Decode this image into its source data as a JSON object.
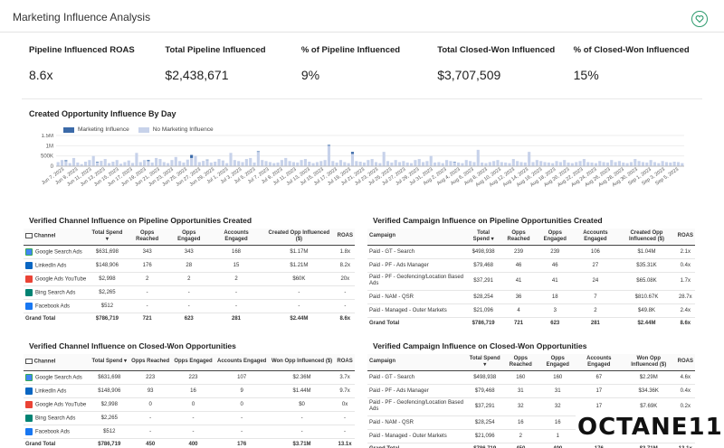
{
  "app_title": "Marketing Influence Analysis",
  "colors": {
    "accent": "#2e9b6e",
    "marketing": "#3b6aa8",
    "no_marketing": "#c7d2ea"
  },
  "kpis": [
    {
      "label": "Pipeline Influenced ROAS",
      "value": "8.6x"
    },
    {
      "label": "Total Pipeline Influenced",
      "value": "$2,438,671"
    },
    {
      "label": "% of Pipeline Influenced",
      "value": "9%"
    },
    {
      "label": "Total Closed-Won Influenced",
      "value": "$3,707,509"
    },
    {
      "label": "% of Closed-Won Influenced",
      "value": "15%"
    }
  ],
  "chart_data": {
    "type": "bar",
    "title": "Created Opportunity Influence By Day",
    "ylim": [
      0,
      1500000
    ],
    "yticks": [
      0,
      500000,
      1000000,
      1500000
    ],
    "ytick_labels": [
      "0",
      "500K",
      "1M",
      "1.5M"
    ],
    "x_tick_labels": [
      "Jun 7, 2023",
      "Jun 9, 2023",
      "Jun 11, 2023",
      "Jun 13, 2023",
      "Jun 15, 2023",
      "Jun 17, 2023",
      "Jun 19, 2023",
      "Jun 21, 2023",
      "Jun 23, 2023",
      "Jun 25, 2023",
      "Jun 27, 2023",
      "Jun 29, 2023",
      "Jul 1, 2023",
      "Jul 3, 2023",
      "Jul 5, 2023",
      "Jul 7, 2023",
      "Jul 9, 2023",
      "Jul 11, 2023",
      "Jul 13, 2023",
      "Jul 15, 2023",
      "Jul 17, 2023",
      "Jul 19, 2023",
      "Jul 21, 2023",
      "Jul 23, 2023",
      "Jul 25, 2023",
      "Jul 27, 2023",
      "Jul 29, 2023",
      "Jul 31, 2023",
      "Aug 2, 2023",
      "Aug 4, 2023",
      "Aug 6, 2023",
      "Aug 8, 2023",
      "Aug 10, 2023",
      "Aug 12, 2023",
      "Aug 14, 2023",
      "Aug 16, 2023",
      "Aug 18, 2023",
      "Aug 20, 2023",
      "Aug 22, 2023",
      "Aug 24, 2023",
      "Aug 26, 2023",
      "Aug 28, 2023",
      "Aug 30, 2023",
      "Sep 1, 2023",
      "Sep 3, 2023",
      "Sep 5, 2023"
    ],
    "series": [
      {
        "name": "Marketing Influence",
        "values": [
          0,
          0,
          40000,
          0,
          0,
          0,
          0,
          0,
          0,
          0,
          30000,
          0,
          0,
          0,
          0,
          0,
          0,
          0,
          0,
          0,
          0,
          0,
          0,
          50000,
          0,
          0,
          0,
          0,
          0,
          0,
          0,
          0,
          0,
          0,
          150000,
          0,
          0,
          0,
          20000,
          0,
          0,
          0,
          0,
          0,
          0,
          0,
          0,
          0,
          0,
          0,
          0,
          30000,
          0,
          0,
          0,
          0,
          0,
          0,
          0,
          0,
          0,
          0,
          0,
          0,
          0,
          0,
          0,
          0,
          0,
          40000,
          0,
          0,
          0,
          0,
          0,
          100000,
          0,
          0,
          0,
          0,
          0,
          0,
          0,
          0,
          0,
          0,
          0,
          0,
          0,
          0,
          0,
          0,
          0,
          0,
          0,
          0,
          0,
          0,
          0,
          0,
          0,
          20000,
          0,
          0,
          0,
          0,
          0,
          0,
          0,
          0,
          0,
          0,
          0,
          0,
          0,
          0,
          0,
          0,
          0,
          0,
          0,
          0,
          0,
          0,
          0,
          0,
          0,
          0,
          0,
          0,
          0,
          0,
          0,
          0,
          0,
          0,
          0,
          0,
          0,
          0,
          0,
          0,
          0,
          0,
          0,
          0,
          0,
          0,
          0,
          0,
          0,
          0,
          0,
          0,
          0,
          0,
          0,
          0,
          0,
          0,
          0,
          0,
          0,
          0
        ]
      },
      {
        "name": "No Marketing Influence",
        "values": [
          200000,
          300000,
          250000,
          150000,
          400000,
          180000,
          100000,
          220000,
          300000,
          500000,
          180000,
          260000,
          350000,
          150000,
          220000,
          300000,
          120000,
          200000,
          280000,
          160000,
          650000,
          200000,
          300000,
          250000,
          180000,
          400000,
          350000,
          200000,
          150000,
          300000,
          450000,
          250000,
          180000,
          320000,
          400000,
          500000,
          200000,
          260000,
          300000,
          180000,
          220000,
          350000,
          280000,
          150000,
          650000,
          300000,
          250000,
          200000,
          350000,
          400000,
          180000,
          700000,
          300000,
          250000,
          200000,
          150000,
          180000,
          300000,
          400000,
          250000,
          200000,
          180000,
          300000,
          350000,
          220000,
          150000,
          200000,
          250000,
          300000,
          1000000,
          250000,
          180000,
          300000,
          200000,
          150000,
          600000,
          250000,
          220000,
          180000,
          300000,
          350000,
          200000,
          150000,
          700000,
          250000,
          180000,
          300000,
          200000,
          250000,
          180000,
          150000,
          300000,
          350000,
          200000,
          250000,
          500000,
          180000,
          200000,
          150000,
          300000,
          250000,
          200000,
          180000,
          150000,
          300000,
          250000,
          200000,
          800000,
          180000,
          150000,
          200000,
          250000,
          300000,
          200000,
          180000,
          150000,
          350000,
          250000,
          200000,
          180000,
          700000,
          200000,
          300000,
          250000,
          200000,
          180000,
          150000,
          250000,
          200000,
          300000,
          180000,
          150000,
          200000,
          250000,
          350000,
          200000,
          180000,
          150000,
          250000,
          200000,
          180000,
          300000,
          200000,
          250000,
          180000,
          150000,
          200000,
          350000,
          250000,
          200000,
          180000,
          300000,
          200000,
          150000,
          250000,
          200000,
          180000,
          220000,
          200000,
          150000
        ]
      }
    ]
  },
  "tables": {
    "channel_pipeline": {
      "title": "Verified Channel Influence on Pipeline Opportunities Created",
      "headers": [
        "Channel",
        "Total Spend ▾",
        "Opps Reached",
        "Opps Engaged",
        "Accounts Engaged",
        "Created Opp Influenced ($)",
        "ROAS"
      ],
      "rows": [
        [
          "Google Search Ads",
          "$631,698",
          "343",
          "343",
          "168",
          "$1.17M",
          "1.8x"
        ],
        [
          "LinkedIn Ads",
          "$148,906",
          "176",
          "28",
          "15",
          "$1.21M",
          "8.2x"
        ],
        [
          "Google Ads YouTube",
          "$2,998",
          "2",
          "2",
          "2",
          "$60K",
          "20x"
        ],
        [
          "Bing Search Ads",
          "$2,265",
          "-",
          "-",
          "-",
          "-",
          "-"
        ],
        [
          "Facebook Ads",
          "$512",
          "-",
          "-",
          "-",
          "-",
          "-"
        ]
      ],
      "total": [
        "Grand Total",
        "$786,719",
        "721",
        "623",
        "281",
        "$2.44M",
        "8.6x"
      ]
    },
    "campaign_pipeline": {
      "title": "Verified Campaign Influence on Pipeline Opportunities Created",
      "headers": [
        "Campaign",
        "Total Spend ▾",
        "Opps Reached",
        "Opps Engaged",
        "Accounts Engaged",
        "Created Opp Influenced ($)",
        "ROAS"
      ],
      "rows": [
        [
          "Paid - GT - Search",
          "$498,938",
          "239",
          "239",
          "106",
          "$1.04M",
          "2.1x"
        ],
        [
          "Paid - PF - Ads Manager",
          "$79,468",
          "46",
          "46",
          "27",
          "$35.31K",
          "0.4x"
        ],
        [
          "Paid - PF - Geofencing/Location Based Ads",
          "$37,291",
          "41",
          "41",
          "24",
          "$65.08K",
          "1.7x"
        ],
        [
          "Paid - NAM - QSR",
          "$28,254",
          "36",
          "18",
          "7",
          "$810.67K",
          "28.7x"
        ],
        [
          "Paid - Managed - Outer Markets",
          "$21,096",
          "4",
          "3",
          "2",
          "$49.8K",
          "2.4x"
        ]
      ],
      "total": [
        "Grand Total",
        "$786,719",
        "721",
        "623",
        "281",
        "$2.44M",
        "8.6x"
      ]
    },
    "channel_won": {
      "title": "Verified Channel Influence on Closed-Won Opportunities",
      "headers": [
        "Channel",
        "Total Spend ▾",
        "Opps Reached",
        "Opps Engaged",
        "Accounts Engaged",
        "Won Opp Influenced ($)",
        "ROAS"
      ],
      "rows": [
        [
          "Google Search Ads",
          "$631,698",
          "223",
          "223",
          "107",
          "$2.36M",
          "3.7x"
        ],
        [
          "LinkedIn Ads",
          "$148,906",
          "93",
          "16",
          "9",
          "$1.44M",
          "9.7x"
        ],
        [
          "Google Ads YouTube",
          "$2,998",
          "0",
          "0",
          "0",
          "$0",
          "0x"
        ],
        [
          "Bing Search Ads",
          "$2,265",
          "-",
          "-",
          "-",
          "-",
          "-"
        ],
        [
          "Facebook Ads",
          "$512",
          "-",
          "-",
          "-",
          "-",
          "-"
        ]
      ],
      "total": [
        "Grand Total",
        "$786,719",
        "450",
        "400",
        "176",
        "$3.71M",
        "13.1x"
      ]
    },
    "campaign_won": {
      "title": "Verified Campaign Influence on Closed-Won Opportunities",
      "headers": [
        "Campaign",
        "Total Spend ▾",
        "Opps Reached",
        "Opps Engaged",
        "Accounts Engaged",
        "Won Opp Influenced ($)",
        "ROAS"
      ],
      "rows": [
        [
          "Paid - GT - Search",
          "$498,938",
          "160",
          "160",
          "67",
          "$2.29M",
          "4.6x"
        ],
        [
          "Paid - PF - Ads Manager",
          "$79,468",
          "31",
          "31",
          "17",
          "$34.36K",
          "0.4x"
        ],
        [
          "Paid - PF - Geofencing/Location Based Ads",
          "$37,291",
          "32",
          "32",
          "17",
          "$7.69K",
          "0.2x"
        ],
        [
          "Paid - NAM - QSR",
          "$28,254",
          "16",
          "16",
          "-",
          "-",
          "-"
        ],
        [
          "Paid - Managed - Outer Markets",
          "$21,096",
          "2",
          "1",
          "-",
          "-",
          "-"
        ]
      ],
      "total": [
        "Grand Total",
        "$786,719",
        "450",
        "400",
        "176",
        "$3.71M",
        "13.1x"
      ]
    }
  },
  "channel_icons": [
    "google-ads-icon",
    "linkedin-icon",
    "youtube-icon",
    "bing-icon",
    "facebook-icon"
  ],
  "brand": {
    "name": "OCTANE11"
  }
}
